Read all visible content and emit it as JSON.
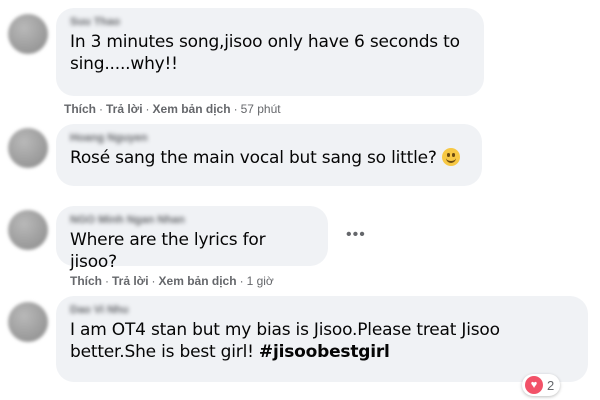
{
  "comments": [
    {
      "name": "Suu Thao",
      "text": "In 3 minutes song,jisoo only have 6 seconds to sing.....why!!",
      "line1": "In 3 minutes song,jisoo only have 6 seconds to",
      "line2": "sing.....why!!",
      "like": "Thích",
      "reply": "Trả lời",
      "translate": "Xem bản dịch",
      "time": "57 phút"
    },
    {
      "name": "Hoang Nguyen",
      "text": "Rosé sang the main vocal but sang so little?",
      "emoji": "smiling-face"
    },
    {
      "name": "NGO Minh Ngan Nhan",
      "text": "Where are the lyrics for jisoo?",
      "like": "Thích",
      "reply": "Trả lời",
      "translate": "Xem bản dịch",
      "time": "1 giờ",
      "more": "•••"
    },
    {
      "name": "Dao Vi Nhu",
      "line1": "I am OT4 stan but my bias is Jisoo.Please treat Jisoo",
      "line2_plain": "better.She is best girl! ",
      "hashtag": "#jisoobestgirl",
      "reaction_icon": "heart-icon",
      "reaction_count": "2"
    }
  ],
  "colors": {
    "bubble": "#f0f2f5",
    "meta": "#65676b",
    "text": "#050505",
    "heart": "#f25268"
  }
}
